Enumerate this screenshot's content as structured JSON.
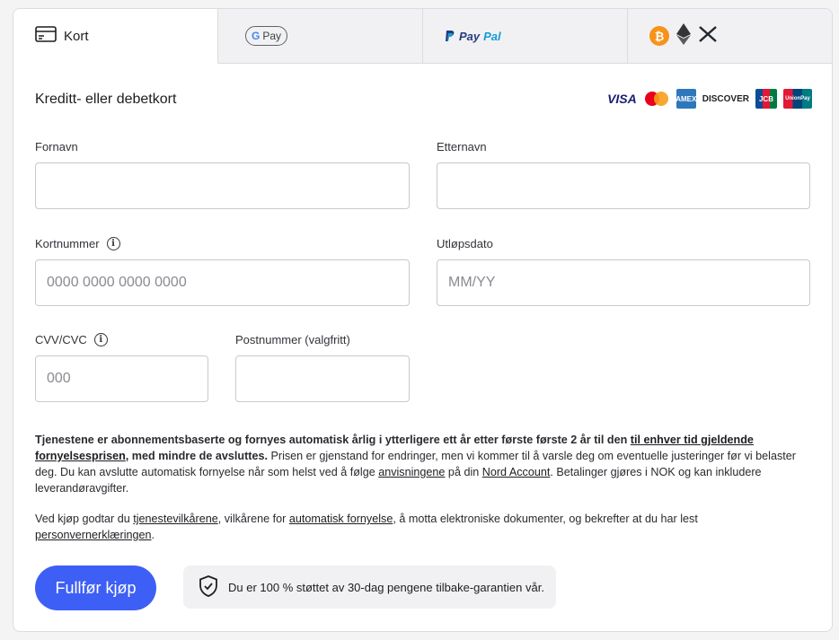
{
  "tabs": [
    {
      "label": "Kort",
      "icon": "credit-card-icon"
    },
    {
      "label": "G Pay",
      "icon": "google-pay-logo"
    },
    {
      "label": "PayPal",
      "icon": "paypal-logo"
    },
    {
      "label": "",
      "icon": "crypto-icons"
    }
  ],
  "form": {
    "title": "Kreditt- eller debetkort",
    "first_name_label": "Fornavn",
    "last_name_label": "Etternavn",
    "card_number_label": "Kortnummer",
    "card_number_placeholder": "0000 0000 0000 0000",
    "expiry_label": "Utløpsdato",
    "expiry_placeholder": "MM/YY",
    "cvv_label": "CVV/CVC",
    "cvv_placeholder": "000",
    "postal_label": "Postnummer (valgfritt)"
  },
  "brands": [
    "VISA",
    "Mastercard",
    "AMEX",
    "DISCOVER",
    "JCB",
    "UnionPay"
  ],
  "legal": {
    "p1_bold": "Tjenestene er abonnementsbaserte og fornyes automatisk årlig i ytterligere ett år etter første første 2 år til den ",
    "p1_link1": "til enhver tid gjeldende fornyelsesprisen",
    "p1_bold2": ", med mindre de avsluttes.",
    "p1_text": " Prisen er gjenstand for endringer, men vi kommer til å varsle deg om eventuelle justeringer før vi belaster deg. Du kan avslutte automatisk fornyelse når som helst ved å følge ",
    "p1_link2": "anvisningene",
    "p1_text2": " på din ",
    "p1_link3": "Nord Account",
    "p1_text3": ". Betalinger gjøres i NOK og kan inkludere leverandøravgifter.",
    "p2_text1": "Ved kjøp godtar du ",
    "p2_link1": "tjenestevilkårene",
    "p2_text2": ", vilkårene for ",
    "p2_link2": "automatisk fornyelse",
    "p2_text3": ", å motta elektroniske dokumenter, og bekrefter at du har lest ",
    "p2_link3": "personvernerklæringen",
    "p2_text4": "."
  },
  "actions": {
    "submit_label": "Fullfør kjøp",
    "guarantee_text": "Du er 100 % støttet av 30-dag pengene tilbake-garantien vår."
  },
  "colors": {
    "accent": "#3e5ff5",
    "bitcoin": "#f7931a"
  }
}
